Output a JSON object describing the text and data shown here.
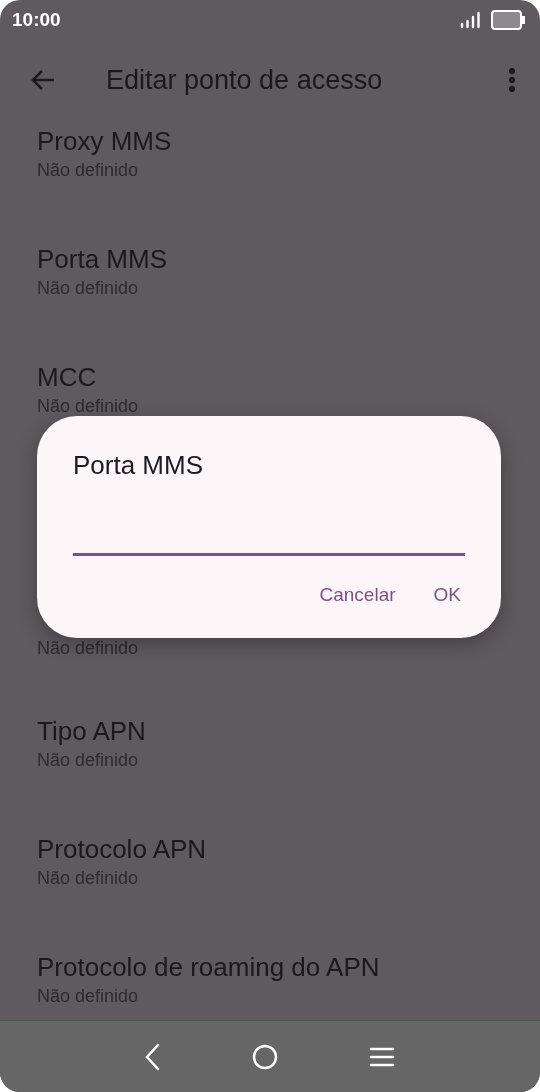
{
  "status_bar": {
    "time": "10:00"
  },
  "toolbar": {
    "title": "Editar ponto de acesso"
  },
  "settings": [
    {
      "title": "Proxy MMS",
      "summary": "Não definido"
    },
    {
      "title": "Porta MMS",
      "summary": "Não definido"
    },
    {
      "title": "MCC",
      "summary": "Não definido"
    },
    {
      "summary": "Não definido"
    },
    {
      "title": "Tipo APN",
      "summary": "Não definido"
    },
    {
      "title": "Protocolo APN",
      "summary": "Não definido"
    },
    {
      "title": "Protocolo de roaming do APN",
      "summary": "Não definido"
    }
  ],
  "dialog": {
    "title": "Porta MMS",
    "buttons": [
      "Cancelar",
      "OK"
    ]
  }
}
